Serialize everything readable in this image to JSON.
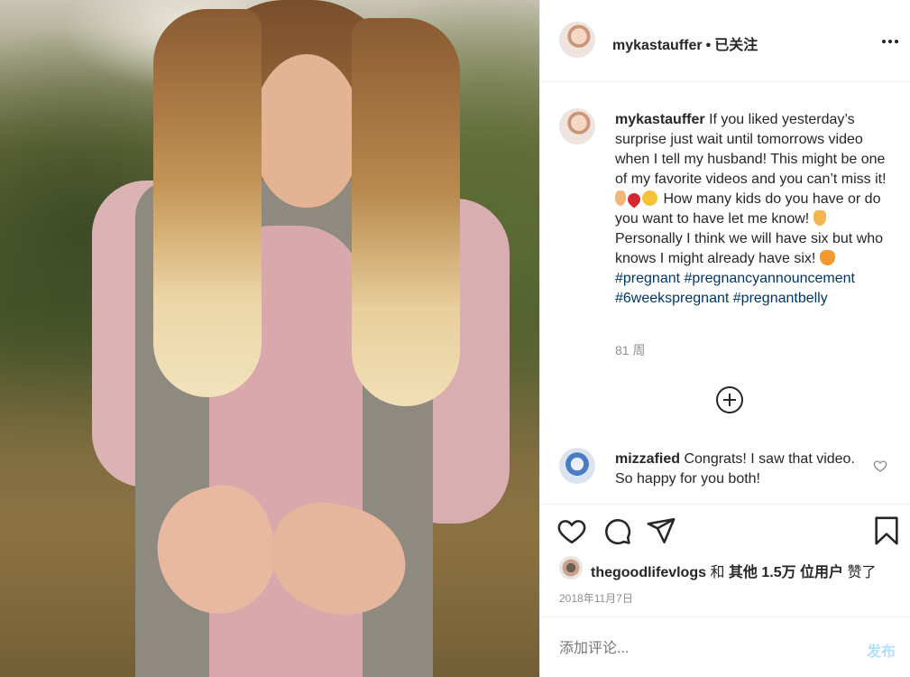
{
  "header": {
    "username": "mykastauffer",
    "separator": "•",
    "follow_status": "已关注"
  },
  "caption": {
    "username": "mykastauffer",
    "text_1": "If you liked yesterday’s surprise just wait until tomorrows video when I tell my husband! This might be one of my favorite videos and you can’t miss it!",
    "text_2": "How many kids do you have or do you want to have let me know!",
    "text_3": "Personally I think we will have six but who knows I might already have six!",
    "hashtags": [
      "#pregnant",
      "#pregnancyannouncement",
      "#6weekspregnant",
      "#pregnantbelly"
    ],
    "time": "81 周",
    "emojis": [
      "woman-emoji",
      "heart-emoji",
      "kiss-emoji",
      "point-down-emoji",
      "cat-emoji"
    ]
  },
  "comment": {
    "username": "mizzafied",
    "text": "Congrats! I saw that video. So happy for you both!"
  },
  "likes": {
    "username": "thegoodlifevlogs",
    "and": "和",
    "others": "其他 1.5万 位用户",
    "liked": "赞了"
  },
  "date": "2018年11月7日",
  "add_comment": {
    "placeholder": "添加评论...",
    "post_label": "发布"
  },
  "colors": {
    "hashtag": "#00376b",
    "post_button_disabled": "#b2dffc",
    "muted": "#8e8e8e"
  },
  "icons": [
    "more-icon",
    "plus-circle-icon",
    "heart-icon",
    "comment-icon",
    "share-icon",
    "bookmark-icon"
  ]
}
